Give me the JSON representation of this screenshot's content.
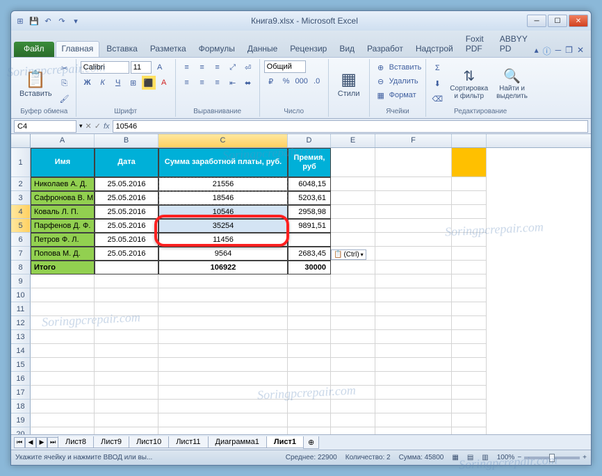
{
  "window": {
    "title": "Книга9.xlsx - Microsoft Excel"
  },
  "qat": {
    "save": "💾",
    "undo": "↶",
    "redo": "↷"
  },
  "tabs": {
    "file": "Файл",
    "home": "Главная",
    "insert": "Вставка",
    "layout": "Разметка",
    "formulas": "Формулы",
    "data": "Данные",
    "review": "Рецензир",
    "view": "Вид",
    "developer": "Разработ",
    "addins": "Надстрой",
    "foxit": "Foxit PDF",
    "abbyy": "ABBYY PD"
  },
  "ribbon": {
    "clipboard": {
      "paste": "Вставить",
      "label": "Буфер обмена"
    },
    "font": {
      "name": "Calibri",
      "size": "11",
      "label": "Шрифт"
    },
    "align": {
      "label": "Выравнивание"
    },
    "number": {
      "format": "Общий",
      "label": "Число"
    },
    "styles": {
      "btn": "Стили"
    },
    "cells": {
      "insert": "Вставить",
      "delete": "Удалить",
      "format": "Формат",
      "label": "Ячейки"
    },
    "editing": {
      "sort": "Сортировка\nи фильтр",
      "find": "Найти и\nвыделить",
      "label": "Редактирование"
    }
  },
  "namebox": {
    "ref": "C4",
    "fx": "fx",
    "formula": "10546"
  },
  "columns": [
    "A",
    "B",
    "C",
    "D",
    "E",
    "F"
  ],
  "headers": {
    "A": "Имя",
    "B": "Дата",
    "C": "Сумма заработной платы, руб.",
    "D": "Премия, руб"
  },
  "rows": [
    {
      "n": "2",
      "A": "Николаев А. Д.",
      "B": "25.05.2016",
      "C": "21556",
      "D": "6048,15"
    },
    {
      "n": "3",
      "A": "Сафронова В. М.",
      "B": "25.05.2016",
      "C": "18546",
      "D": "5203,61"
    },
    {
      "n": "4",
      "A": "Коваль Л. П.",
      "B": "25.05.2016",
      "C": "10546",
      "D": "2958,98"
    },
    {
      "n": "5",
      "A": "Парфенов Д. Ф.",
      "B": "25.05.2016",
      "C": "35254",
      "D": "9891,51"
    },
    {
      "n": "6",
      "A": "Петров Ф. Л.",
      "B": "25.05.2016",
      "C": "11456",
      "D": ""
    },
    {
      "n": "7",
      "A": "Попова М. Д.",
      "B": "25.05.2016",
      "C": "9564",
      "D": "2683,45"
    }
  ],
  "total": {
    "n": "8",
    "A": "Итого",
    "C": "106922",
    "D": "30000"
  },
  "paste_tag": "(Ctrl)",
  "sheets": {
    "s8": "Лист8",
    "s9": "Лист9",
    "s10": "Лист10",
    "s11": "Лист11",
    "diag": "Диаграмма1",
    "s1": "Лист1"
  },
  "status": {
    "msg": "Укажите ячейку и нажмите ВВОД или вы...",
    "avg_l": "Среднее:",
    "avg_v": "22900",
    "cnt_l": "Количество:",
    "cnt_v": "2",
    "sum_l": "Сумма:",
    "sum_v": "45800",
    "zoom": "100%"
  },
  "wm": "Soringpcrepair.com"
}
